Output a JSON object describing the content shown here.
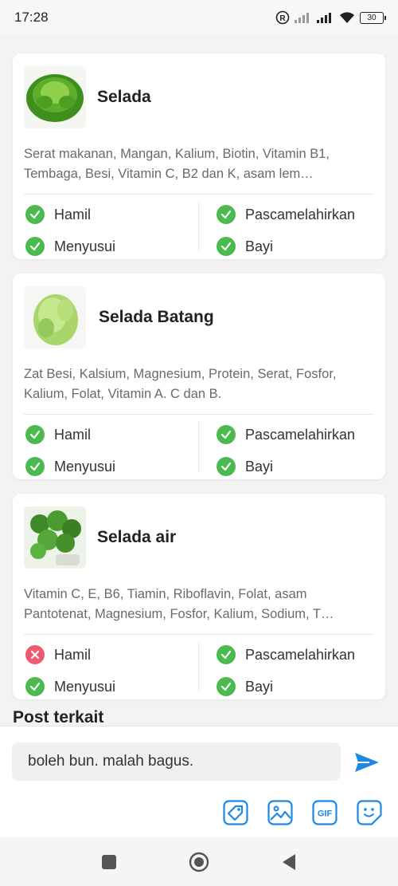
{
  "status_bar": {
    "time": "17:28",
    "battery": "30"
  },
  "cards": [
    {
      "title": "Selada",
      "description": "Serat makanan, Mangan, Kalium, Biotin, Vitamin B1, Tembaga, Besi, Vitamin C, B2 dan K, asam lem…",
      "statuses": [
        {
          "label": "Hamil",
          "state": "ok"
        },
        {
          "label": "Pascamelahirkan",
          "state": "ok"
        },
        {
          "label": "Menyusui",
          "state": "ok"
        },
        {
          "label": "Bayi",
          "state": "ok"
        }
      ]
    },
    {
      "title": "Selada Batang",
      "description": "Zat Besi, Kalsium, Magnesium, Protein, Serat, Fosfor, Kalium, Folat, Vitamin A. C dan B.",
      "statuses": [
        {
          "label": "Hamil",
          "state": "ok"
        },
        {
          "label": "Pascamelahirkan",
          "state": "ok"
        },
        {
          "label": "Menyusui",
          "state": "ok"
        },
        {
          "label": "Bayi",
          "state": "ok"
        }
      ]
    },
    {
      "title": "Selada air",
      "description": "Vitamin C, E, B6, Tiamin, Riboflavin, Folat, asam Pantotenat, Magnesium, Fosfor, Kalium, Sodium, T…",
      "statuses": [
        {
          "label": "Hamil",
          "state": "no"
        },
        {
          "label": "Pascamelahirkan",
          "state": "ok"
        },
        {
          "label": "Menyusui",
          "state": "ok"
        },
        {
          "label": "Bayi",
          "state": "ok"
        }
      ]
    }
  ],
  "section": {
    "post_terkait": "Post terkait"
  },
  "composer": {
    "input_value": "boleh bun. malah bagus."
  },
  "colors": {
    "ok": "#4cbb4f",
    "no": "#ee5a6f",
    "accent": "#1e88e5"
  }
}
